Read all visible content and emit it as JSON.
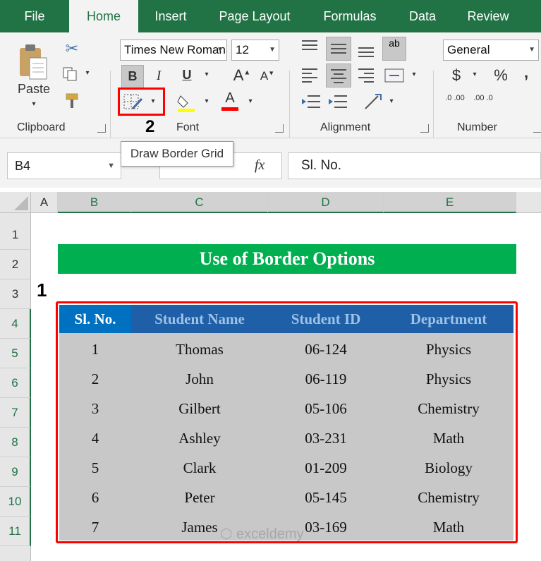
{
  "tabs": [
    "File",
    "Home",
    "Insert",
    "Page Layout",
    "Formulas",
    "Data",
    "Review"
  ],
  "active_tab": "Home",
  "ribbon": {
    "paste_label": "Paste",
    "groups": {
      "clipboard": "Clipboard",
      "font": "Font",
      "alignment": "Alignment",
      "number": "Number"
    },
    "font_name": "Times New Roman",
    "font_size": "12",
    "number_format": "General",
    "bold": "B",
    "italic": "I",
    "underline": "U",
    "currency": "$",
    "percent": "%",
    "comma": ",",
    "grow_font": "A",
    "shrink_font": "A",
    "font_color_letter": "A",
    "dec_inc": ".0 .00",
    "dec_dec": ".00 .0",
    "wrap_icon": "ab"
  },
  "tooltip": "Draw Border Grid",
  "callouts": {
    "one": "1",
    "two": "2"
  },
  "formula_bar": {
    "name_box": "B4",
    "fx": "fx",
    "content": "Sl. No."
  },
  "columns": [
    "A",
    "B",
    "C",
    "D",
    "E"
  ],
  "rows": [
    "1",
    "2",
    "3",
    "4",
    "5",
    "6",
    "7",
    "8",
    "9",
    "10",
    "11"
  ],
  "sheet": {
    "title": "Use of Border Options",
    "headers": [
      "Sl. No.",
      "Student Name",
      "Student ID",
      "Department"
    ],
    "data": [
      [
        "1",
        "Thomas",
        "06-124",
        "Physics"
      ],
      [
        "2",
        "John",
        "06-119",
        "Physics"
      ],
      [
        "3",
        "Gilbert",
        "05-106",
        "Chemistry"
      ],
      [
        "4",
        "Ashley",
        "03-231",
        "Math"
      ],
      [
        "5",
        "Clark",
        "01-209",
        "Biology"
      ],
      [
        "6",
        "Peter",
        "05-145",
        "Chemistry"
      ],
      [
        "7",
        "James",
        "03-169",
        "Math"
      ]
    ]
  },
  "watermark": "exceldemy",
  "colors": {
    "excel_green": "#217346",
    "title_green": "#00b050",
    "header_blue": "#1f5fa8",
    "header_text": "#9dc3e6",
    "table_gray": "#c8c8c8",
    "highlight_red": "#ff0000"
  }
}
